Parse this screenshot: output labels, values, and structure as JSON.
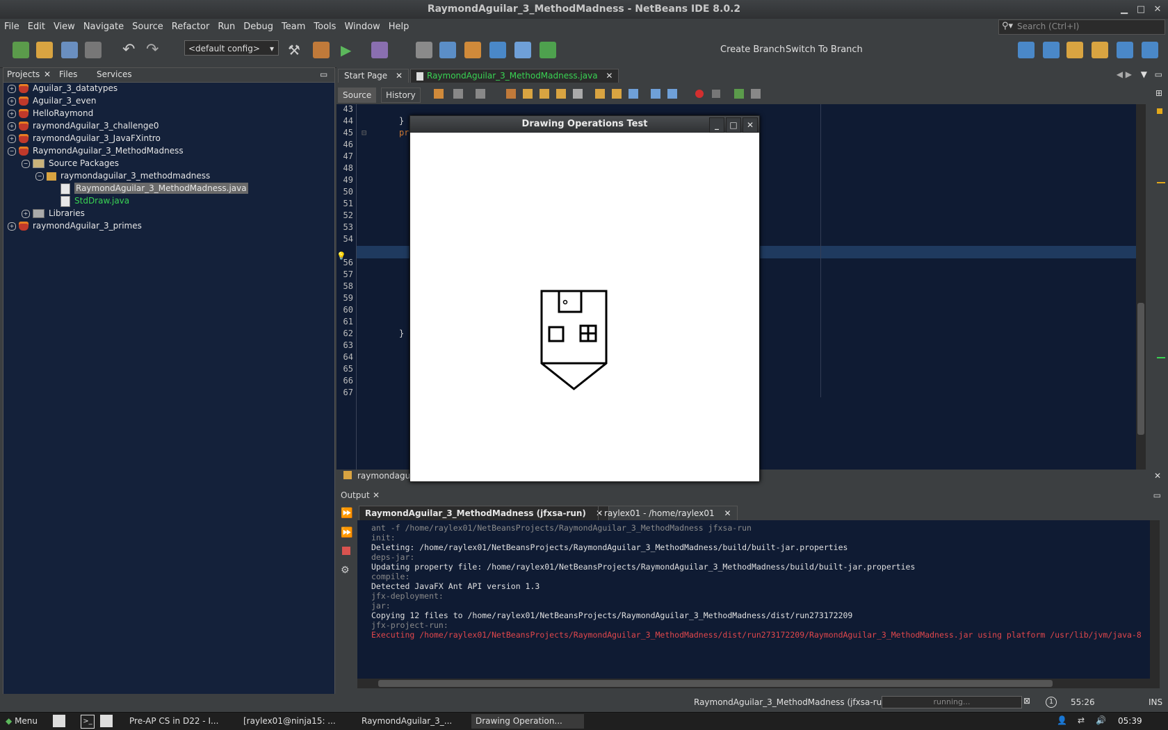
{
  "window": {
    "title": "RaymondAguilar_3_MethodMadness - NetBeans IDE 8.0.2"
  },
  "menu": [
    "File",
    "Edit",
    "View",
    "Navigate",
    "Source",
    "Refactor",
    "Run",
    "Debug",
    "Team",
    "Tools",
    "Window",
    "Help"
  ],
  "search": {
    "placeholder": "Search (Ctrl+I)"
  },
  "toolbar": {
    "config": "<default config>",
    "create_branch": "Create Branch",
    "switch_branch": "Switch To Branch"
  },
  "left_tabs": [
    "Projects",
    "Files",
    "Services"
  ],
  "tree": [
    {
      "label": "Aguilar_3_datatypes"
    },
    {
      "label": "Aguilar_3_even"
    },
    {
      "label": "HelloRaymond"
    },
    {
      "label": "raymondAguilar_3_challenge0"
    },
    {
      "label": "raymondAguilar_3_JavaFXintro"
    },
    {
      "label": "RaymondAguilar_3_MethodMadness"
    },
    {
      "label": "Source Packages"
    },
    {
      "label": "raymondaguilar_3_methodmadness"
    },
    {
      "label": "RaymondAguilar_3_MethodMadness.java"
    },
    {
      "label": "StdDraw.java"
    },
    {
      "label": "Libraries"
    },
    {
      "label": "raymondAguilar_3_primes"
    }
  ],
  "editor_tabs": [
    "Start Page",
    "RaymondAguilar_3_MethodMadness.java"
  ],
  "editor_modes": [
    "Source",
    "History"
  ],
  "line_numbers": [
    "43",
    "44",
    "45",
    "46",
    "47",
    "48",
    "49",
    "50",
    "51",
    "52",
    "53",
    "54",
    "55",
    "56",
    "57",
    "58",
    "59",
    "60",
    "61",
    "62",
    "63",
    "64",
    "65",
    "66",
    "67"
  ],
  "code": {
    "l44": "}",
    "l45": "pr",
    "l62": "}"
  },
  "navigator": "raymondagui",
  "draw_window": {
    "title": "Drawing Operations Test"
  },
  "output": {
    "header": "Output",
    "tabs": [
      "RaymondAguilar_3_MethodMadness (jfxsa-run)",
      "raylex01 - /home/raylex01"
    ],
    "lines": [
      {
        "text": "ant -f /home/raylex01/NetBeansProjects/RaymondAguilar_3_MethodMadness jfxsa-run",
        "kind": "dim"
      },
      {
        "text": "init:",
        "kind": "dim"
      },
      {
        "text": "Deleting: /home/raylex01/NetBeansProjects/RaymondAguilar_3_MethodMadness/build/built-jar.properties",
        "kind": "normal"
      },
      {
        "text": "deps-jar:",
        "kind": "dim"
      },
      {
        "text": "Updating property file: /home/raylex01/NetBeansProjects/RaymondAguilar_3_MethodMadness/build/built-jar.properties",
        "kind": "normal"
      },
      {
        "text": "compile:",
        "kind": "dim"
      },
      {
        "text": "Detected JavaFX Ant API version 1.3",
        "kind": "normal"
      },
      {
        "text": "jfx-deployment:",
        "kind": "dim"
      },
      {
        "text": "jar:",
        "kind": "dim"
      },
      {
        "text": "Copying 12 files to /home/raylex01/NetBeansProjects/RaymondAguilar_3_MethodMadness/dist/run273172209",
        "kind": "normal"
      },
      {
        "text": "jfx-project-run:",
        "kind": "dim"
      },
      {
        "text": "Executing /home/raylex01/NetBeansProjects/RaymondAguilar_3_MethodMadness/dist/run273172209/RaymondAguilar_3_MethodMadness.jar using platform /usr/lib/jvm/java-8",
        "kind": "error"
      }
    ]
  },
  "status": {
    "task": "RaymondAguilar_3_MethodMadness (jfxsa-run)",
    "progress": "running...",
    "position": "55:26",
    "mode": "INS",
    "notif": "1"
  },
  "taskbar": {
    "menu": "Menu",
    "tasks": [
      "Pre-AP CS in D22 - I...",
      "[raylex01@ninja15: ...",
      "RaymondAguilar_3_...",
      "Drawing Operation..."
    ],
    "clock": "05:39"
  },
  "colors": {
    "bg": "#3c3f41",
    "editor_bg": "#0f1b33",
    "error": "#e0474c",
    "green_file": "#39d353"
  }
}
